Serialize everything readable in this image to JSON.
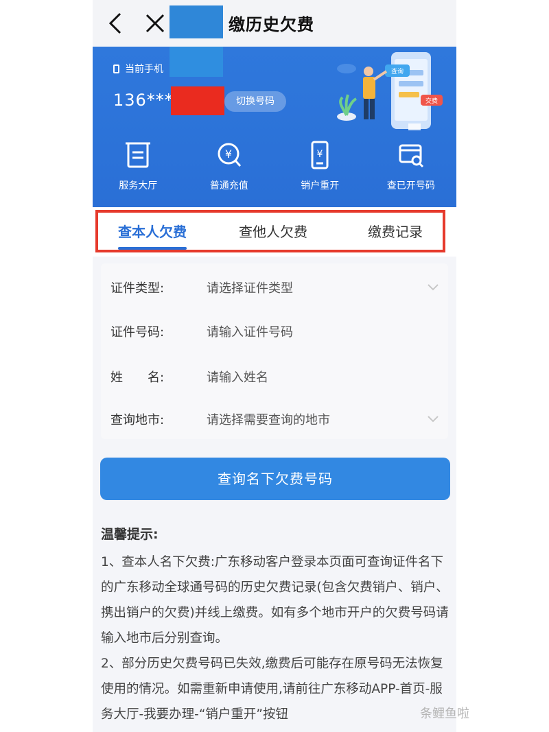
{
  "nav": {
    "title": "缴历史欠费"
  },
  "account": {
    "phone_label": "当前手机",
    "phone_number": "136***",
    "switch_label": "切换号码"
  },
  "illustration": {
    "bubble_1": "查询",
    "bubble_2": "交费"
  },
  "quick_menu": [
    {
      "label": "服务大厅",
      "icon": "receipt-icon"
    },
    {
      "label": "普通充值",
      "icon": "yuan-search-icon"
    },
    {
      "label": "销户重开",
      "icon": "phone-yuan-icon"
    },
    {
      "label": "查已开号码",
      "icon": "card-search-icon"
    }
  ],
  "tabs": [
    {
      "label": "查本人欠费",
      "active": true
    },
    {
      "label": "查他人欠费",
      "active": false
    },
    {
      "label": "缴费记录",
      "active": false
    }
  ],
  "form": {
    "id_type": {
      "label": "证件类型:",
      "placeholder": "请选择证件类型"
    },
    "id_number": {
      "label": "证件号码:",
      "placeholder": "请输入证件号码"
    },
    "name": {
      "label": "姓　　名:",
      "placeholder": "请输入姓名"
    },
    "city": {
      "label": "查询地市:",
      "placeholder": "请选择需要查询的地市"
    }
  },
  "query_button": "查询名下欠费号码",
  "tips": {
    "title": "温馨提示:",
    "line_1": "1、查本人名下欠费:广东移动客户登录本页面可查询证件名下的广东移动全球通号码的历史欠费记录(包含欠费销户、销户、携出销户的欠费)并线上缴费。如有多个地市开户的欠费号码请输入地市后分别查询。",
    "line_2": "2、部分历史欠费号码已失效,缴费后可能存在原号码无法恢复使用的情况。如需重新申请使用,请前往广东移动APP-首页-服务大厅-我要办理-“销户重开”按钮"
  },
  "watermark": "条鲤鱼啦",
  "colors": {
    "brand_blue": "#2a6fd6",
    "button_blue": "#3288e2",
    "highlight_red": "#e63a2c"
  }
}
